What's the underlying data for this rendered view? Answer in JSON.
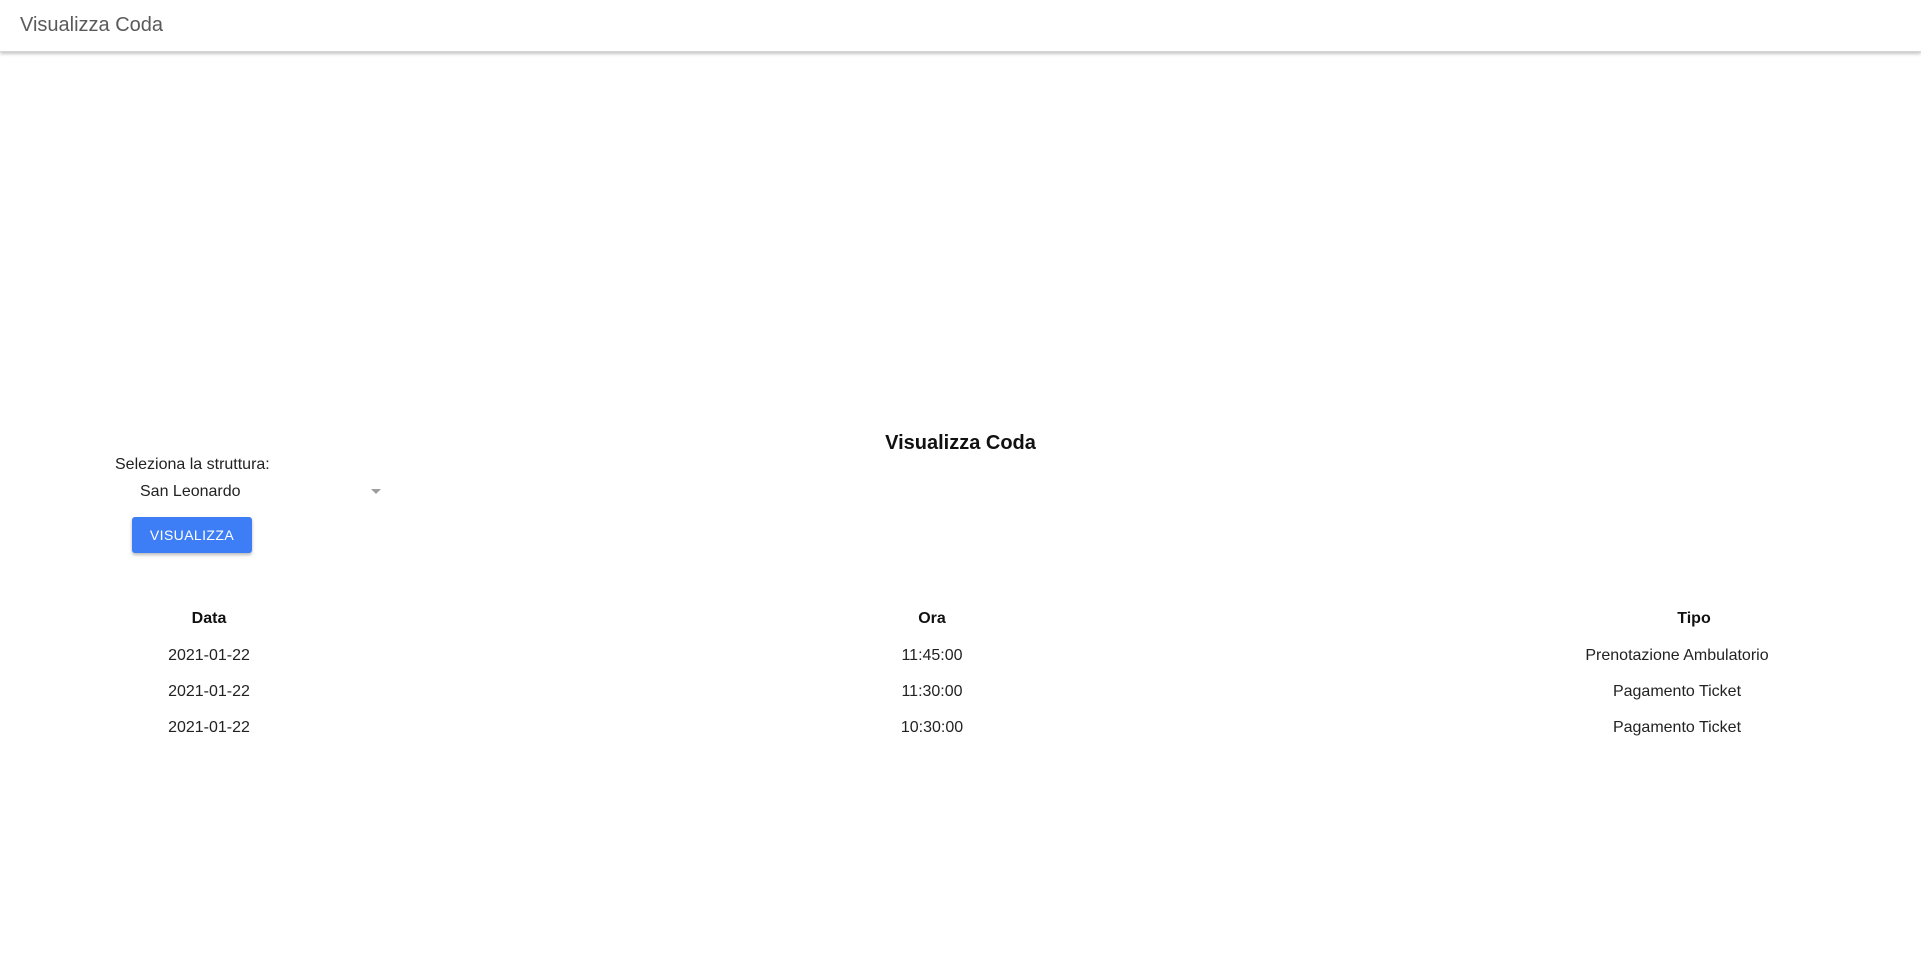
{
  "app_bar": {
    "title": "Visualizza Coda"
  },
  "main": {
    "title": "Visualizza Coda",
    "struttura_label": "Seleziona la struttura:",
    "struttura_selected": "San Leonardo",
    "visualizza_button": "VISUALIZZA"
  },
  "table": {
    "headers": [
      "Data",
      "Ora",
      "Tipo"
    ],
    "rows": [
      [
        "2021-01-22",
        "11:45:00",
        "Prenotazione Ambulatorio"
      ],
      [
        "2021-01-22",
        "11:30:00",
        "Pagamento Ticket"
      ],
      [
        "2021-01-22",
        "10:30:00",
        "Pagamento Ticket"
      ]
    ]
  },
  "colors": {
    "accent": "#3d7ef6",
    "app_bar_bg": "#ffffff",
    "page_bg": "#ffffff"
  },
  "icons": {
    "select_arrow": "chevron-down-icon"
  }
}
